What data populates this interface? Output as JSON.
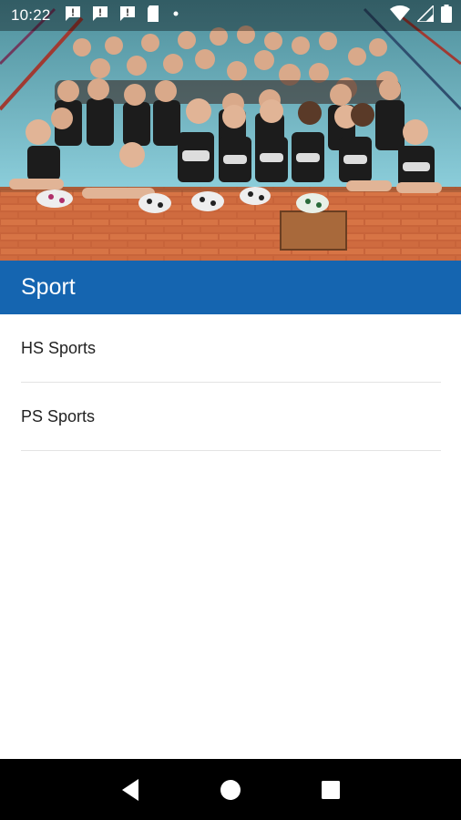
{
  "status_bar": {
    "time": "10:22",
    "notification_icons": [
      "message-alert-icon",
      "message-alert-icon",
      "message-alert-icon",
      "sim-card-icon",
      "dot-icon"
    ],
    "right_icons": [
      "wifi-icon",
      "signal-icon",
      "battery-icon"
    ]
  },
  "hero": {
    "image": "swim-team-photo"
  },
  "app_bar": {
    "title": "Sport",
    "color": "#1565b0"
  },
  "list": {
    "items": [
      {
        "label": "HS Sports"
      },
      {
        "label": "PS Sports"
      }
    ]
  },
  "nav_bar": {
    "buttons": [
      "back-icon",
      "home-icon",
      "recents-icon"
    ]
  }
}
